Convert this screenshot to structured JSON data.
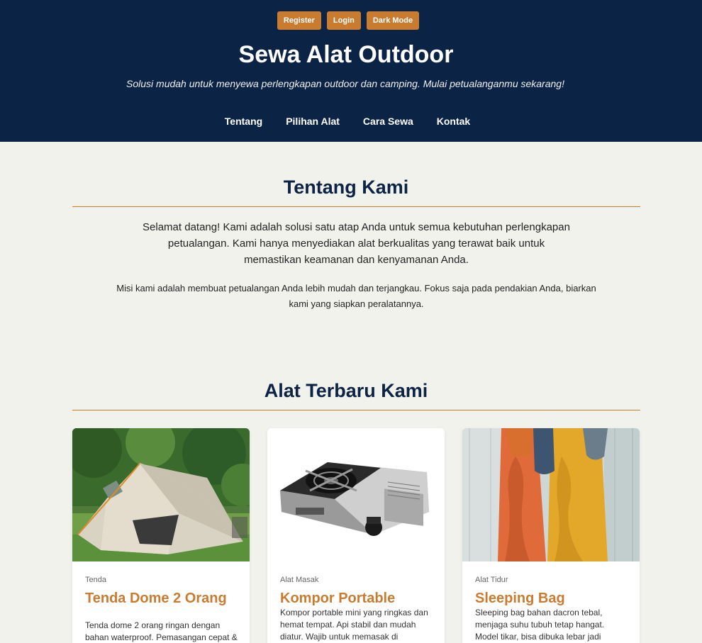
{
  "header": {
    "auth": {
      "register": "Register",
      "login": "Login",
      "dark_mode": "Dark Mode"
    },
    "title": "Sewa Alat Outdoor",
    "tagline": "Solusi mudah untuk menyewa perlengkapan outdoor dan camping. Mulai petualanganmu sekarang!",
    "nav": [
      "Tentang",
      "Pilihan Alat",
      "Cara Sewa",
      "Kontak"
    ]
  },
  "about": {
    "title": "Tentang Kami",
    "paragraph1": "Selamat datang! Kami adalah solusi satu atap Anda untuk semua kebutuhan perlengkapan petualangan. Kami hanya menyediakan alat berkualitas yang terawat baik untuk memastikan keamanan dan kenyamanan Anda.",
    "paragraph2": "Misi kami adalah membuat petualangan Anda lebih mudah dan terjangkau. Fokus saja pada pendakian Anda, biarkan kami yang siapkan peralatannya."
  },
  "tools": {
    "title": "Alat Terbaru Kami",
    "items": [
      {
        "category": "Tenda",
        "name": "Tenda Dome 2 Orang",
        "description": "Tenda dome 2 orang ringan dengan bahan waterproof. Pemasangan cepat &"
      },
      {
        "category": "Alat Masak",
        "name": "Kompor Portable",
        "description": "Kompor portable mini yang ringkas dan hemat tempat. Api stabil dan mudah diatur. Wajib untuk memasak di"
      },
      {
        "category": "Alat Tidur",
        "name": "Sleeping Bag",
        "description": "Sleeping bag bahan dacron tebal, menjaga suhu tubuh tetap hangat. Model tikar, bisa dibuka lebar jadi"
      }
    ]
  },
  "colors": {
    "header_bg": "#0b2345",
    "accent": "#c97c30",
    "page_bg": "#f2f2ed"
  }
}
